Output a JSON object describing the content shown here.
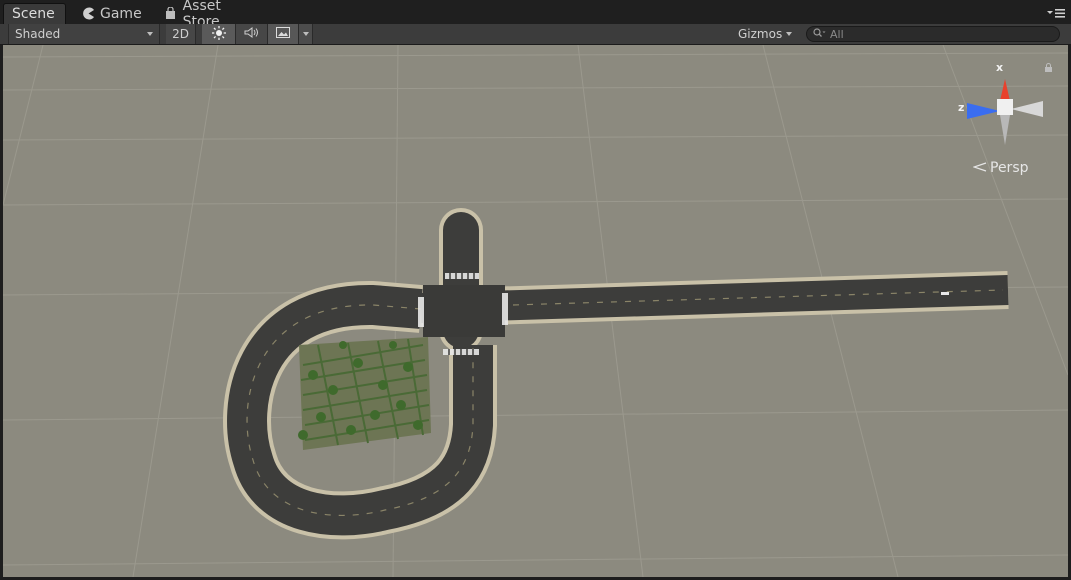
{
  "tabs": [
    {
      "label": "Scene",
      "icon": "scene-icon",
      "active": true
    },
    {
      "label": "Game",
      "icon": "pacman-icon",
      "active": false
    },
    {
      "label": "Asset Store",
      "icon": "store-bag-icon",
      "active": false
    }
  ],
  "toolbar": {
    "draw_mode": "Shaded",
    "mode_2d": "2D",
    "lighting_icon": "sun-icon",
    "audio_icon": "speaker-icon",
    "effects_icon": "image-icon",
    "gizmos_label": "Gizmos",
    "search_placeholder": "All"
  },
  "scene_gizmo": {
    "x_label": "x",
    "z_label": "z",
    "projection": "Persp",
    "colors": {
      "x": "#e8412c",
      "z": "#3a6df0",
      "y": "#c8c8c8"
    }
  },
  "colors": {
    "viewport_ground": "#8c8a7f",
    "grid_line": "#9c9a8f",
    "road": "#3c3c3a",
    "road_border": "#c9c1a8",
    "trees": "#4e6b3a"
  }
}
